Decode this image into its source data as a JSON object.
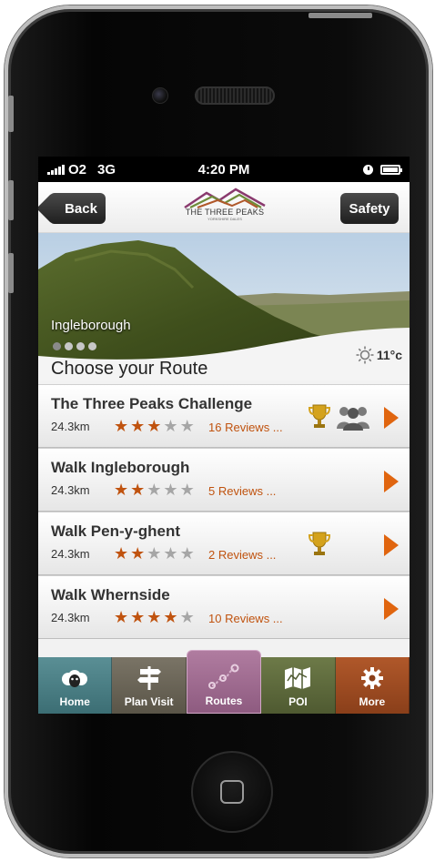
{
  "status_bar": {
    "carrier": "O2",
    "network": "3G",
    "time": "4:20 PM"
  },
  "nav": {
    "back_label": "Back",
    "safety_label": "Safety",
    "logo_title": "THE THREE PEAKS",
    "logo_subtitle": "YORKSHIRE DALES"
  },
  "hero": {
    "location": "Ingleborough",
    "temperature": "11°c",
    "heading": "Choose your Route",
    "page_count": 4,
    "active_page": 1
  },
  "routes": [
    {
      "title": "The Three Peaks Challenge",
      "distance": "24.3km",
      "rating": 3,
      "max_rating": 5,
      "reviews": "16 Reviews ...",
      "badges": [
        "trophy-icon",
        "group-icon"
      ]
    },
    {
      "title": "Walk Ingleborough",
      "distance": "24.3km",
      "rating": 2,
      "max_rating": 5,
      "reviews": "5 Reviews ...",
      "badges": []
    },
    {
      "title": "Walk Pen-y-ghent",
      "distance": "24.3km",
      "rating": 2,
      "max_rating": 5,
      "reviews": "2 Reviews ...",
      "badges": [
        "trophy-icon"
      ]
    },
    {
      "title": "Walk Whernside",
      "distance": "24.3km",
      "rating": 4,
      "max_rating": 5,
      "reviews": "10 Reviews ...",
      "badges": []
    }
  ],
  "tabs": [
    {
      "label": "Home",
      "icon": "sheep-icon"
    },
    {
      "label": "Plan Visit",
      "icon": "signpost-icon"
    },
    {
      "label": "Routes",
      "icon": "route-icon",
      "active": true
    },
    {
      "label": "POI",
      "icon": "map-icon"
    },
    {
      "label": "More",
      "icon": "gear-icon"
    }
  ],
  "colors": {
    "accent_orange": "#e0650f",
    "star_on": "#c0530f",
    "star_off": "#a6a6a6"
  }
}
